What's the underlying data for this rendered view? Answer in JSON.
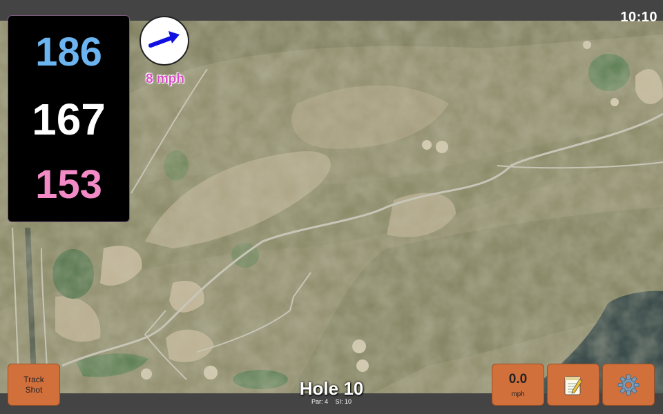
{
  "status": {
    "clock": "10:10"
  },
  "distances": {
    "back": "186",
    "middle": "167",
    "front": "153"
  },
  "wind": {
    "speed": "8 mph",
    "icon": "wind-arrow-icon"
  },
  "buttons": {
    "track_shot_line1": "Track",
    "track_shot_line2": "Shot",
    "speed_value": "0.0",
    "speed_unit": "mph",
    "notes_icon": "notepad-icon",
    "settings_icon": "gear-icon"
  },
  "hole": {
    "title": "Hole 10",
    "par": "Par: 4",
    "si": "SI: 10"
  },
  "colors": {
    "back": "#6cb4f0",
    "middle": "#ffffff",
    "front": "#f28ac6",
    "button": "#d2703c",
    "wind_text": "#d64fc2"
  }
}
